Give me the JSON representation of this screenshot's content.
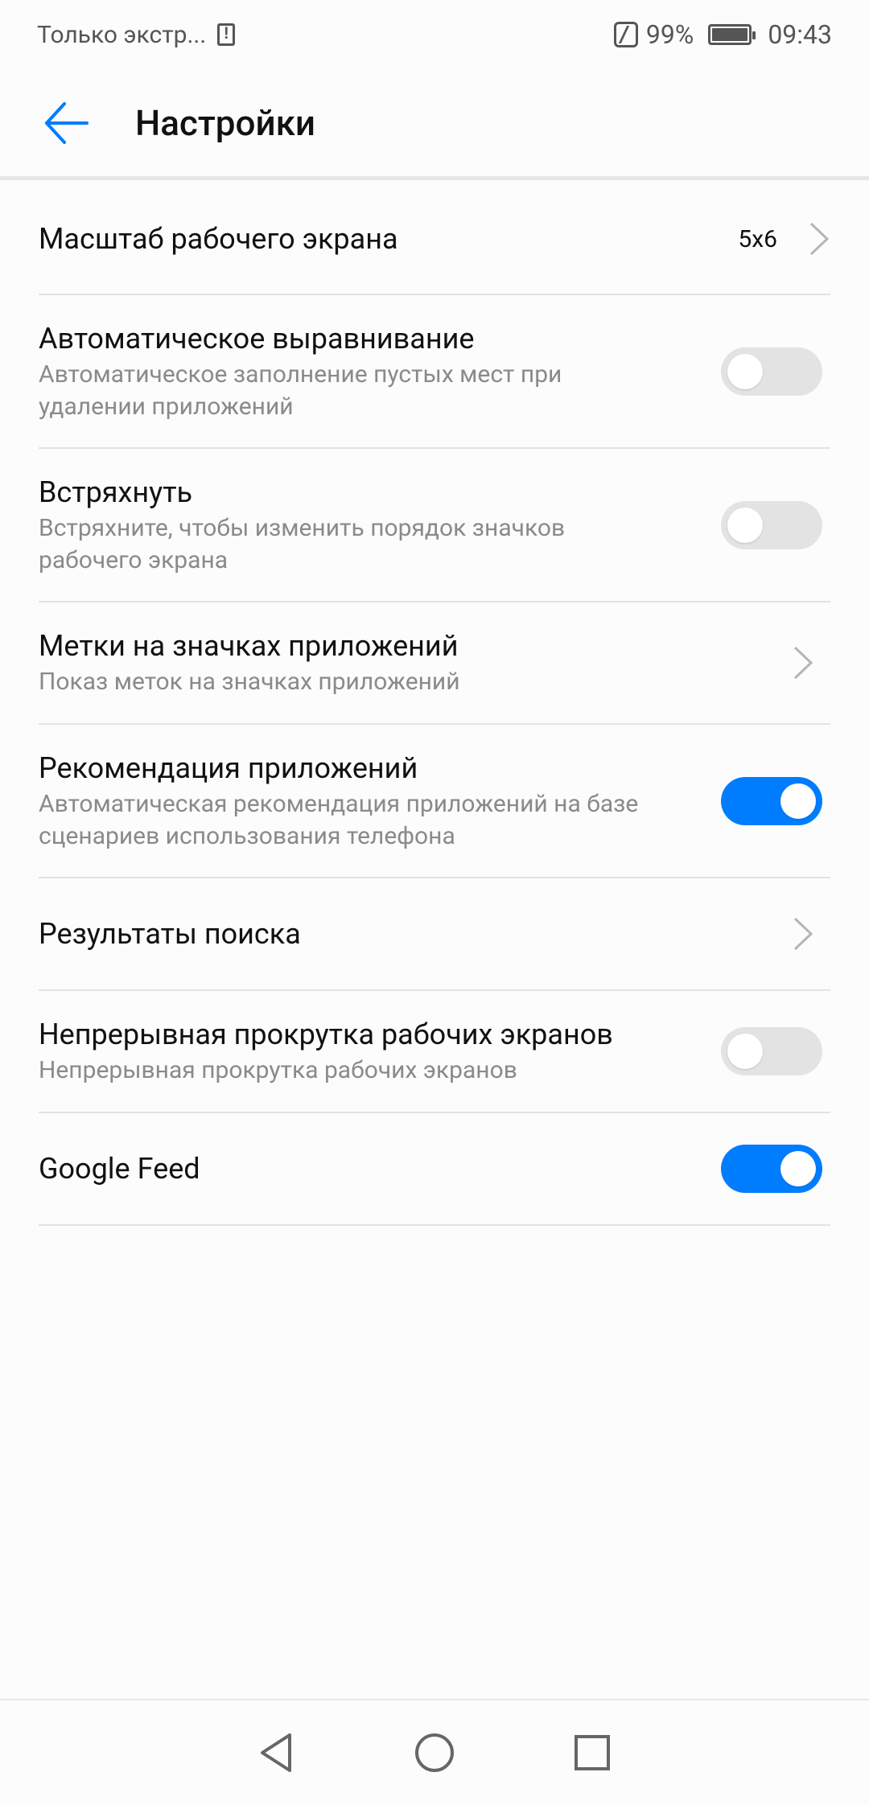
{
  "status_bar": {
    "carrier": "Только экстр...",
    "battery": "99%",
    "time": "09:43"
  },
  "header": {
    "title": "Настройки"
  },
  "settings": {
    "scale": {
      "title": "Масштаб рабочего экрана",
      "value": "5x6"
    },
    "auto_align": {
      "title": "Автоматическое выравнивание",
      "subtitle": "Автоматическое заполнение пустых мест при удалении приложений",
      "enabled": false
    },
    "shake": {
      "title": "Встряхнуть",
      "subtitle": "Встряхните, чтобы изменить порядок значков рабочего экрана",
      "enabled": false
    },
    "badges": {
      "title": "Метки на значках приложений",
      "subtitle": "Показ меток на значках приложений"
    },
    "recommend": {
      "title": "Рекомендация приложений",
      "subtitle": "Автоматическая рекомендация приложений на базе сценариев использования телефона",
      "enabled": true
    },
    "search": {
      "title": "Результаты поиска"
    },
    "continuous": {
      "title": "Непрерывная прокрутка рабочих экранов",
      "subtitle": "Непрерывная прокрутка рабочих экранов",
      "enabled": false
    },
    "google_feed": {
      "title": "Google Feed",
      "enabled": true
    }
  },
  "colors": {
    "accent": "#007dff",
    "toggle_off": "#e3e3e3"
  }
}
